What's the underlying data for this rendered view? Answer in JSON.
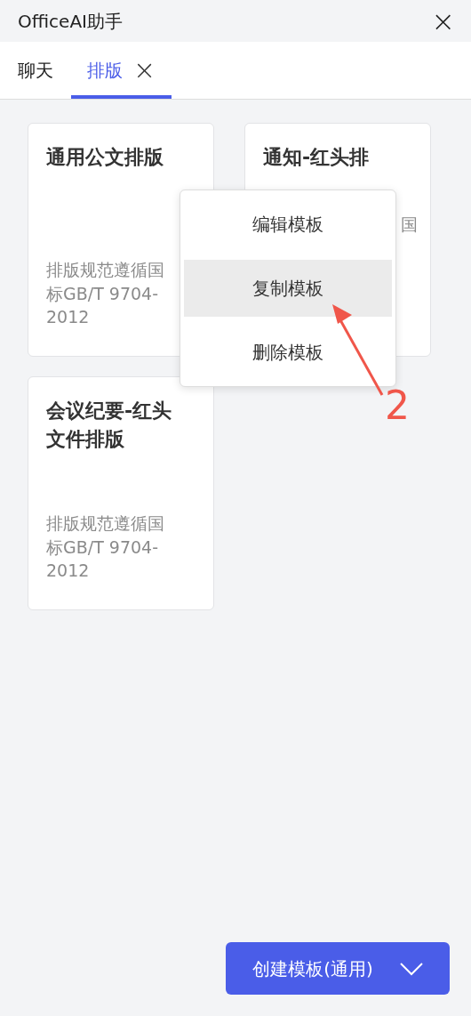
{
  "window": {
    "title": "OfficeAI助手",
    "close": "×"
  },
  "tabs": [
    {
      "label": "聊天",
      "selected": false
    },
    {
      "label": "排版",
      "selected": true,
      "close": "×"
    }
  ],
  "templates": [
    {
      "title": "通用公文排版",
      "description": "排版规范遵循国标GB/T 9704-2012"
    },
    {
      "title": "通知-红头排",
      "description": "国"
    },
    {
      "title": "会议纪要-红头文件排版",
      "description": "排版规范遵循国标GB/T 9704-2012"
    }
  ],
  "context_menu": {
    "items": [
      {
        "label": "编辑模板",
        "selected": false
      },
      {
        "label": "复制模板",
        "selected": true
      },
      {
        "label": "删除模板",
        "selected": false
      }
    ]
  },
  "annotation": {
    "label": "2"
  },
  "create_button": {
    "label": "创建模板(通用)"
  }
}
